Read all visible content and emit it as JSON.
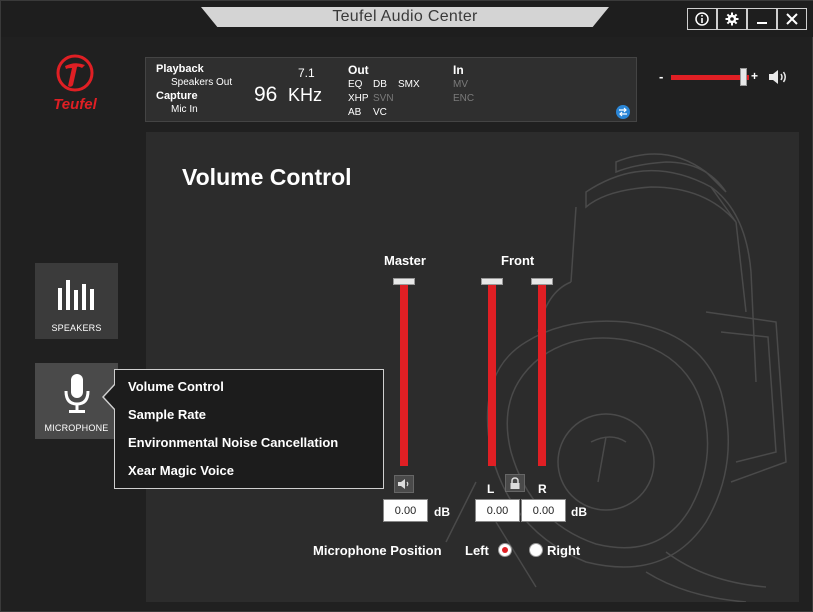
{
  "window": {
    "title": "Teufel Audio Center"
  },
  "colors": {
    "accent": "#e01f24",
    "panel": "#2c2c2c",
    "info_icon_blue": "#2b86d6"
  },
  "logo": {
    "text": "Teufel"
  },
  "info_panel": {
    "playback_label": "Playback",
    "playback_device": "Speakers Out",
    "capture_label": "Capture",
    "capture_device": "Mic In",
    "channels": "7.1",
    "sample_rate": "96",
    "sample_rate_unit": "KHz",
    "out_label": "Out",
    "out_items": [
      {
        "label": "EQ",
        "active": true
      },
      {
        "label": "DB",
        "active": true
      },
      {
        "label": "SMX",
        "active": true
      },
      {
        "label": "XHP",
        "active": true
      },
      {
        "label": "SVN",
        "active": false
      },
      {
        "label": "AB",
        "active": true
      },
      {
        "label": "VC",
        "active": true
      }
    ],
    "in_label": "In",
    "in_items": [
      {
        "label": "MV",
        "active": false
      },
      {
        "label": "ENC",
        "active": false
      }
    ]
  },
  "top_volume": {
    "minus": "-",
    "plus": "+",
    "level": 0.9
  },
  "nav": {
    "speakers_label": "SPEAKERS",
    "microphone_label": "MICROPHONE"
  },
  "mic_menu": {
    "items": [
      "Volume Control",
      "Sample Rate",
      "Environmental Noise Cancellation",
      "Xear Magic Voice"
    ]
  },
  "main": {
    "title": "Volume Control",
    "master_label": "Master",
    "front_label": "Front",
    "left_label": "L",
    "right_label": "R",
    "master_db": "0.00",
    "front_l_db": "0.00",
    "front_r_db": "0.00",
    "db_unit": "dB",
    "master_level": 1.0,
    "front_l_level": 1.0,
    "front_r_level": 1.0,
    "mic_position_label": "Microphone Position",
    "mic_position_options": [
      "Left",
      "Right"
    ],
    "mic_position_selected": "Left"
  }
}
